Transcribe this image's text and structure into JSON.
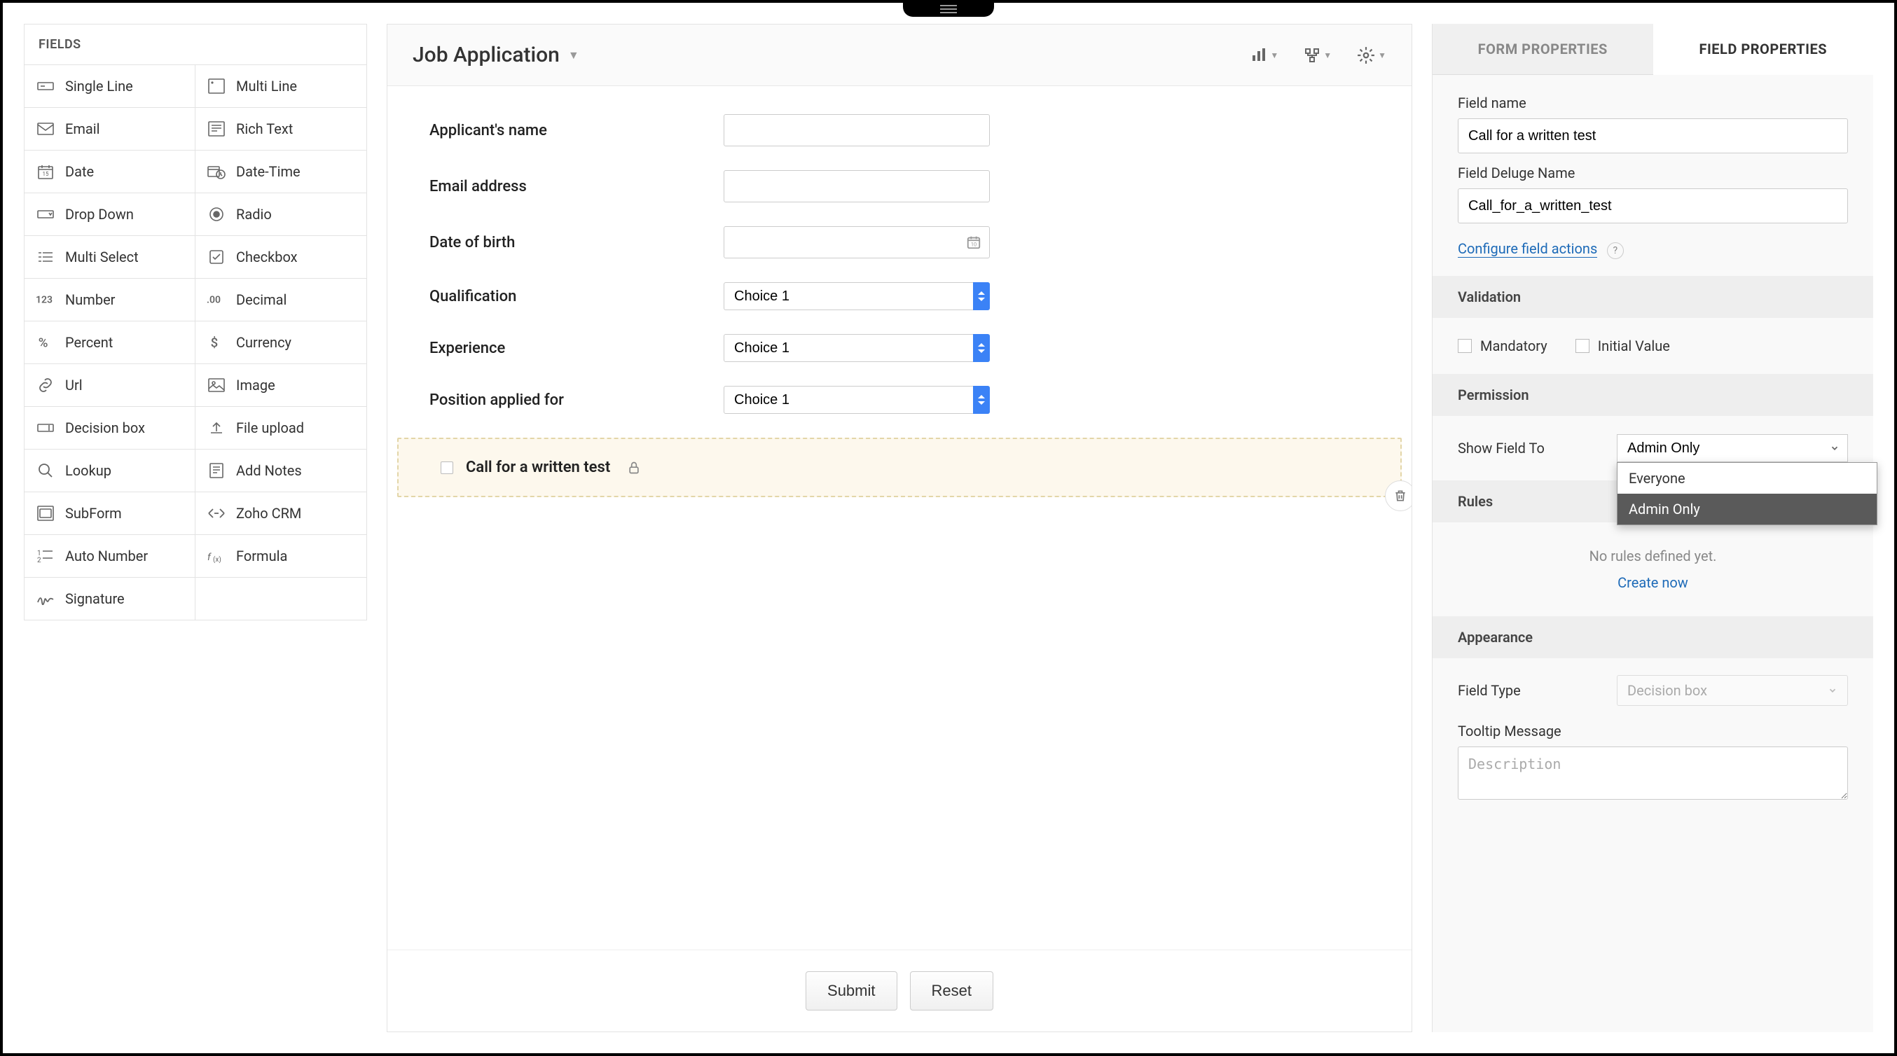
{
  "fields_panel": {
    "header": "FIELDS",
    "types": [
      {
        "label": "Single Line",
        "icon": "single-line"
      },
      {
        "label": "Multi Line",
        "icon": "multi-line"
      },
      {
        "label": "Email",
        "icon": "mail"
      },
      {
        "label": "Rich Text",
        "icon": "rich-text"
      },
      {
        "label": "Date",
        "icon": "date"
      },
      {
        "label": "Date-Time",
        "icon": "date-time"
      },
      {
        "label": "Drop Down",
        "icon": "dropdown"
      },
      {
        "label": "Radio",
        "icon": "radio"
      },
      {
        "label": "Multi Select",
        "icon": "multi-select"
      },
      {
        "label": "Checkbox",
        "icon": "checkbox"
      },
      {
        "label": "Number",
        "icon": "number"
      },
      {
        "label": "Decimal",
        "icon": "decimal"
      },
      {
        "label": "Percent",
        "icon": "percent"
      },
      {
        "label": "Currency",
        "icon": "currency"
      },
      {
        "label": "Url",
        "icon": "url"
      },
      {
        "label": "Image",
        "icon": "image"
      },
      {
        "label": "Decision box",
        "icon": "decision"
      },
      {
        "label": "File upload",
        "icon": "file-upload"
      },
      {
        "label": "Lookup",
        "icon": "lookup"
      },
      {
        "label": "Add Notes",
        "icon": "notes"
      },
      {
        "label": "SubForm",
        "icon": "subform"
      },
      {
        "label": "Zoho CRM",
        "icon": "crm"
      },
      {
        "label": "Auto Number",
        "icon": "auto-number"
      },
      {
        "label": "Formula",
        "icon": "formula"
      },
      {
        "label": "Signature",
        "icon": "signature"
      }
    ]
  },
  "form": {
    "title": "Job Application",
    "fields": {
      "applicant_name": {
        "label": "Applicant's name",
        "value": ""
      },
      "email": {
        "label": "Email address",
        "value": ""
      },
      "dob": {
        "label": "Date of birth",
        "value": ""
      },
      "qualification": {
        "label": "Qualification",
        "value": "Choice 1"
      },
      "experience": {
        "label": "Experience",
        "value": "Choice 1"
      },
      "position": {
        "label": "Position applied for",
        "value": "Choice 1"
      }
    },
    "selected_field": {
      "label": "Call for a written test"
    },
    "buttons": {
      "submit": "Submit",
      "reset": "Reset"
    }
  },
  "props": {
    "tabs": {
      "form": "FORM PROPERTIES",
      "field": "FIELD PROPERTIES"
    },
    "field_name": {
      "label": "Field name",
      "value": "Call for a written test"
    },
    "deluge_name": {
      "label": "Field Deluge Name",
      "value": "Call_for_a_written_test"
    },
    "configure_action": "Configure field actions",
    "validation": {
      "header": "Validation",
      "mandatory": "Mandatory",
      "initial": "Initial Value"
    },
    "permission": {
      "header": "Permission",
      "show_field_to": "Show Field To",
      "selected": "Admin Only",
      "options": [
        "Everyone",
        "Admin Only"
      ]
    },
    "rules": {
      "header": "Rules",
      "empty": "No rules defined yet.",
      "create": "Create now"
    },
    "appearance": {
      "header": "Appearance",
      "field_type_label": "Field Type",
      "field_type_value": "Decision box",
      "tooltip_label": "Tooltip Message",
      "tooltip_placeholder": "Description"
    }
  }
}
